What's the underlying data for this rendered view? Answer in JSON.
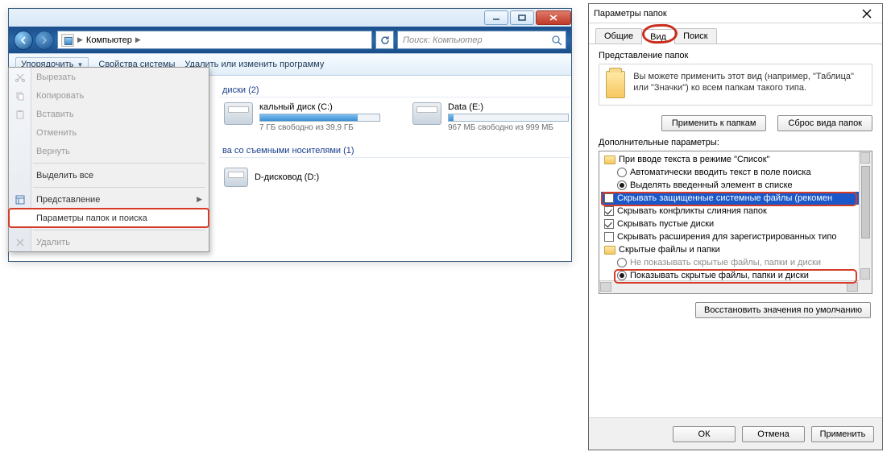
{
  "explorer": {
    "crumb": "Компьютер",
    "search_ph": "Поиск: Компьютер",
    "toolbar": {
      "organize": "Упорядочить",
      "sys_props": "Свойства системы",
      "uninstall": "Удалить или изменить программу"
    },
    "menu": {
      "cut": "Вырезать",
      "copy": "Копировать",
      "paste": "Вставить",
      "undo": "Отменить",
      "redo": "Вернуть",
      "select_all": "Выделить все",
      "layout": "Представление",
      "folder_opts": "Параметры папок и поиска",
      "delete": "Удалить"
    },
    "groups": {
      "hdd_partial": "диски (2)",
      "removable_partial": "ва со съемными носителями (1)",
      "dvd_partial": "D-дисковод (D:)"
    },
    "drives": {
      "c": {
        "name_partial": "кальный диск (C:)",
        "free_partial": "7 ГБ свободно из 39,9 ГБ",
        "fill": 82
      },
      "e": {
        "name": "Data (E:)",
        "free": "967 МБ свободно из 999 МБ",
        "fill": 4
      }
    }
  },
  "dlg": {
    "title": "Параметры папок",
    "tabs": {
      "general": "Общие",
      "view": "Вид",
      "search": "Поиск"
    },
    "fv_group": "Представление папок",
    "fv_text": "Вы можете применить этот вид (например, \"Таблица\" или \"Значки\") ко всем папкам такого типа.",
    "apply_folders": "Применить к папкам",
    "reset_folders": "Сброс вида папок",
    "adv_label": "Дополнительные параметры:",
    "nodes": {
      "n0": "При вводе текста в режиме \"Список\"",
      "n1": "Автоматически вводить текст в поле поиска",
      "n2": "Выделять введенный элемент в списке",
      "n3": "Скрывать защищенные системные файлы (рекомен",
      "n4": "Скрывать конфликты слияния папок",
      "n5": "Скрывать пустые диски",
      "n6": "Скрывать расширения для зарегистрированных типо",
      "n7": "Скрытые файлы и папки",
      "n8": "Не показывать скрытые файлы, папки и диски",
      "n9": "Показывать скрытые файлы, папки и диски"
    },
    "restore": "Восстановить значения по умолчанию",
    "ok": "ОК",
    "cancel": "Отмена",
    "apply": "Применить"
  }
}
